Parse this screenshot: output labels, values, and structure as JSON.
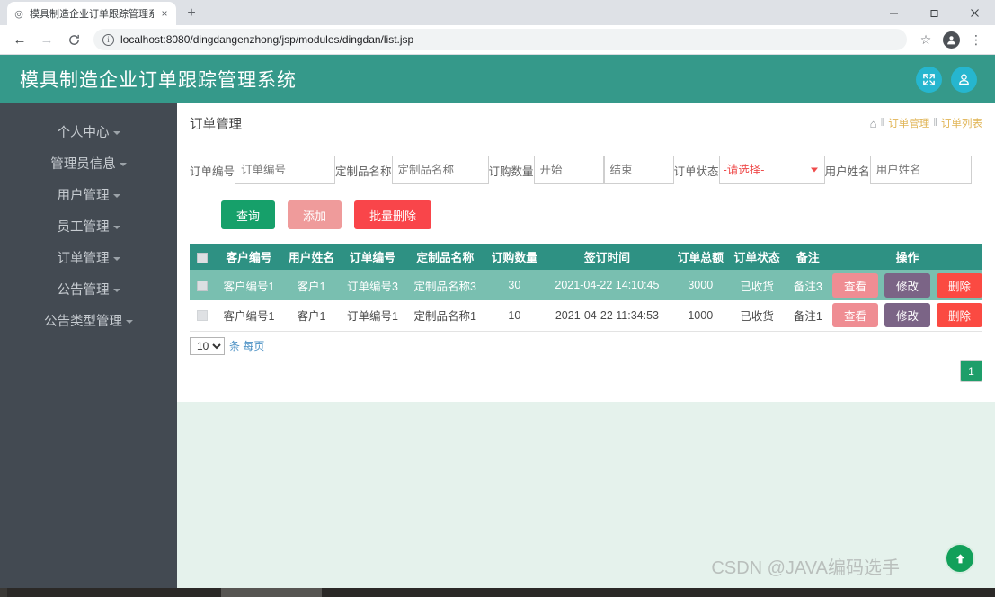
{
  "browser": {
    "tab": {
      "title": "模具制造企业订单跟踪管理系统",
      "favicon": "◎",
      "close": "×"
    },
    "new_tab": "+",
    "window": {
      "minimize": "—",
      "maximize": "❐",
      "close": "✕"
    },
    "toolbar": {
      "back": "←",
      "forward": "→",
      "reload": "C",
      "info_icon": "i",
      "url": "localhost:8080/dingdangenzhong/jsp/modules/dingdan/list.jsp",
      "star": "☆",
      "menu": "⋮"
    }
  },
  "app": {
    "title": "模具制造企业订单跟踪管理系统",
    "header_buttons": [
      {
        "name": "fullscreen-button",
        "icon": "expand-arrows-icon"
      },
      {
        "name": "user-button",
        "icon": "user-icon"
      }
    ],
    "accent_teal": "#35998a",
    "sidebar_bg": "#434a52",
    "table_header_bg": "#2e9183",
    "row_alt_bg": "#79bfb0"
  },
  "sidebar": {
    "items": [
      {
        "label": "个人中心"
      },
      {
        "label": "管理员信息"
      },
      {
        "label": "用户管理"
      },
      {
        "label": "员工管理"
      },
      {
        "label": "订单管理"
      },
      {
        "label": "公告管理"
      },
      {
        "label": "公告类型管理"
      }
    ]
  },
  "page": {
    "title": "订单管理",
    "breadcrumb": {
      "home_icon": "⌂",
      "sep": "‖",
      "parent": "订单管理",
      "current": "订单列表"
    }
  },
  "filters": {
    "order_no": {
      "label": "订单编号",
      "placeholder": "订单编号",
      "value": ""
    },
    "product_name": {
      "label": "定制品名称",
      "placeholder": "定制品名称",
      "value": ""
    },
    "quantity": {
      "label": "订购数量",
      "start_placeholder": "开始",
      "end_placeholder": "结束",
      "start_value": "",
      "end_value": ""
    },
    "status": {
      "label": "订单状态",
      "selected": "-请选择-",
      "options": [
        "-请选择-"
      ]
    },
    "user_name": {
      "label": "用户姓名",
      "placeholder": "用户姓名",
      "value": ""
    }
  },
  "actions": {
    "query": "查询",
    "add": "添加",
    "batch_delete": "批量删除"
  },
  "table": {
    "columns": [
      "",
      "客户编号",
      "用户姓名",
      "订单编号",
      "定制品名称",
      "订购数量",
      "签订时间",
      "订单总额",
      "订单状态",
      "备注",
      "操作"
    ],
    "rows": [
      {
        "customer_no": "客户编号1",
        "user_name": "客户1",
        "order_no": "订单编号3",
        "product_name": "定制品名称3",
        "quantity": "30",
        "sign_time": "2021-04-22 14:10:45",
        "total": "3000",
        "status": "已收货",
        "remark": "备注3"
      },
      {
        "customer_no": "客户编号1",
        "user_name": "客户1",
        "order_no": "订单编号1",
        "product_name": "定制品名称1",
        "quantity": "10",
        "sign_time": "2021-04-22 11:34:53",
        "total": "1000",
        "status": "已收货",
        "remark": "备注1"
      }
    ],
    "row_actions": {
      "view": "查看",
      "edit": "修改",
      "delete": "删除"
    }
  },
  "pagination": {
    "page_size": "10",
    "page_size_options": [
      "10"
    ],
    "suffix": "条 每页",
    "current_page": "1"
  },
  "footer": {
    "watermark": "CSDN @JAVA编码选手",
    "scroll_top_icon": "up-arrow-icon"
  }
}
